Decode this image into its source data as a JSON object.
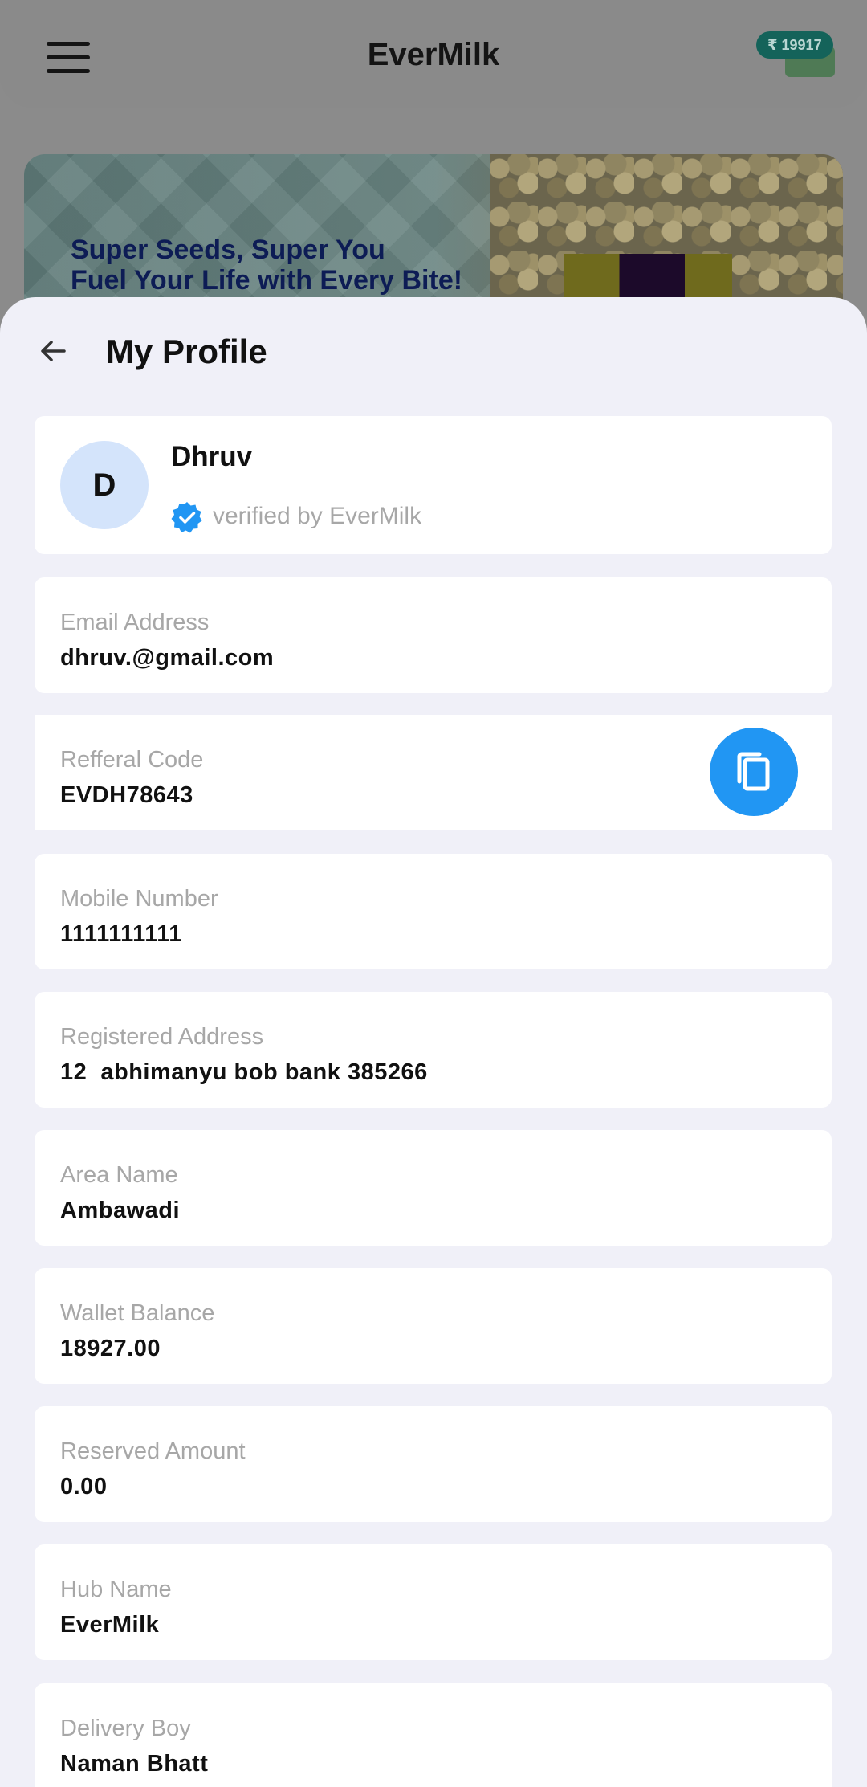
{
  "header": {
    "title": "EverMilk",
    "wallet_badge": "₹ 19917",
    "menu_icon": "hamburger-menu-icon"
  },
  "banner": {
    "line1": "Super Seeds, Super You",
    "line2": "Fuel Your Life with Every Bite!"
  },
  "sheet": {
    "title": "My Profile",
    "back_icon": "arrow-left-icon"
  },
  "profile": {
    "initial": "D",
    "name": "Dhruv",
    "verified_text": "verified by EverMilk",
    "verified_icon": "verified-badge-icon"
  },
  "fields": {
    "email": {
      "label": "Email Address",
      "value": "dhruv.@gmail.com"
    },
    "referral": {
      "label": "Refferal Code",
      "value": "EVDH78643",
      "action_icon": "copy-icon"
    },
    "mobile": {
      "label": "Mobile Number",
      "value": "1111111111"
    },
    "address": {
      "label": "Registered Address",
      "value": "12  abhimanyu bob bank 385266"
    },
    "area": {
      "label": "Area Name",
      "value": "Ambawadi"
    },
    "wallet": {
      "label": "Wallet Balance",
      "value": "18927.00"
    },
    "reserved": {
      "label": "Reserved Amount",
      "value": "0.00"
    },
    "hub": {
      "label": "Hub Name",
      "value": "EverMilk"
    },
    "delivery": {
      "label": "Delivery Boy",
      "value": "Naman Bhatt"
    }
  },
  "colors": {
    "accent": "#2196f3",
    "sheet_bg": "#f0f0f8",
    "avatar_bg": "#d4e4fb",
    "badge_bg": "#14635a"
  }
}
